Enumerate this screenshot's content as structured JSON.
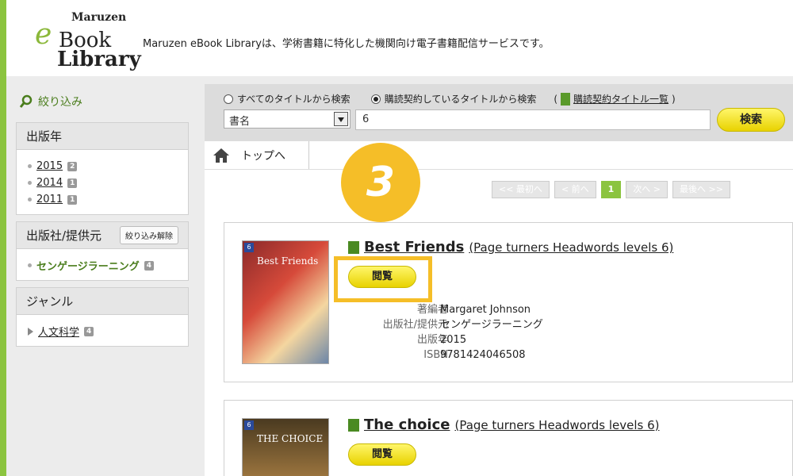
{
  "header": {
    "logo": {
      "line1": "Maruzen",
      "line2": "eBook",
      "line3": "Library"
    },
    "tagline": "Maruzen eBook Libraryは、学術書籍に特化した機関向け電子書籍配信サービスです。"
  },
  "sidebar": {
    "refine_title": "絞り込み",
    "year": {
      "title": "出版年",
      "items": [
        {
          "label": "2015",
          "count": "2"
        },
        {
          "label": "2014",
          "count": "1"
        },
        {
          "label": "2011",
          "count": "1"
        }
      ]
    },
    "publisher": {
      "title": "出版社/提供元",
      "clear_label": "絞り込み解除",
      "items": [
        {
          "label": "センゲージラーニング",
          "count": "4"
        }
      ]
    },
    "genre": {
      "title": "ジャンル",
      "items": [
        {
          "label": "人文科学",
          "count": "4"
        }
      ]
    }
  },
  "search": {
    "radio_all": "すべてのタイトルから検索",
    "radio_subscribed": "購読契約しているタイトルから検索",
    "list_open": "(",
    "list_link": "購読契約タイトル一覧",
    "list_close": ")",
    "field_selected": "書名",
    "query": "6",
    "button": "検索"
  },
  "nav": {
    "home": "トップへ"
  },
  "pager": {
    "first": "<< 最初へ",
    "prev": "< 前へ",
    "current": "1",
    "next": "次へ >",
    "last": "最後へ >>"
  },
  "step": "3",
  "meta_labels": {
    "author": "著編者",
    "publisher": "出版社/提供元",
    "year": "出版年",
    "isbn": "ISBN"
  },
  "books": [
    {
      "title": "Best Friends",
      "series": "(Page turners Headwords levels 6)",
      "view": "閲覧",
      "cover_level": "6",
      "cover_title": "Best Friends",
      "author": "Margaret Johnson",
      "publisher": "センゲージラーニング",
      "year": "2015",
      "isbn": "9781424046508"
    },
    {
      "title": "The choice",
      "series": "(Page turners Headwords levels 6)",
      "view": "閲覧",
      "cover_level": "6",
      "cover_title": "THE CHOICE"
    }
  ],
  "colors": {
    "accent_green": "#8bc43f",
    "button_yellow": "#f0dc20",
    "highlight": "#f5be28"
  }
}
